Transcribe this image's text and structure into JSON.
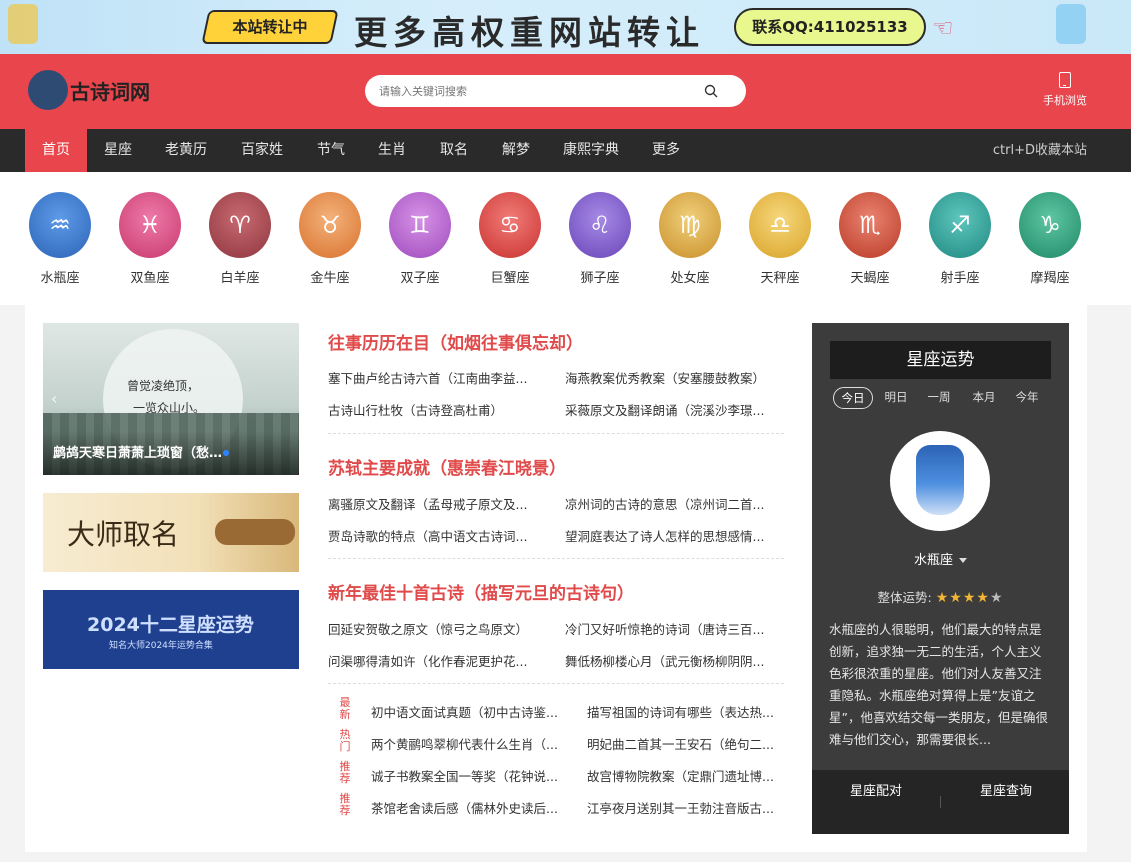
{
  "banner": {
    "tag": "本站转让中",
    "title": "更多高权重网站转让",
    "contact": "联系QQ:411025133"
  },
  "header": {
    "logo_text": "古诗词网",
    "search_placeholder": "请输入关键词搜索",
    "mobile_label": "手机浏览"
  },
  "nav": {
    "items": [
      "首页",
      "星座",
      "老黄历",
      "百家姓",
      "节气",
      "生肖",
      "取名",
      "解梦",
      "康熙字典",
      "更多"
    ],
    "active_index": 0,
    "bookmark_hint": "ctrl+D收藏本站"
  },
  "zodiac": [
    {
      "name": "水瓶座",
      "color": "#3d7fd6"
    },
    {
      "name": "双鱼座",
      "color": "#d6487e"
    },
    {
      "name": "白羊座",
      "color": "#a3404a"
    },
    {
      "name": "金牛座",
      "color": "#e0843a"
    },
    {
      "name": "双子座",
      "color": "#b055c9"
    },
    {
      "name": "巨蟹座",
      "color": "#d9413f"
    },
    {
      "name": "狮子座",
      "color": "#7b55c9"
    },
    {
      "name": "处女座",
      "color": "#d9a23c"
    },
    {
      "name": "天秤座",
      "color": "#e2b23a"
    },
    {
      "name": "天蝎座",
      "color": "#c94836"
    },
    {
      "name": "射手座",
      "color": "#2a9a93"
    },
    {
      "name": "摩羯座",
      "color": "#2a9a7a"
    }
  ],
  "left": {
    "slider_caption": "鹧鸪天寒日萧萧上琐窗（愁…",
    "slider_calligraphy_1": "曾觉凌绝顶，",
    "slider_calligraphy_2": "一览众山小。",
    "ad1_text": "大师取名",
    "ad2_title": "2024十二星座运势",
    "ad2_subtitle": "知名大师2024年运势合集"
  },
  "groups": [
    {
      "title": "往事历历在目（如烟往事俱忘却）",
      "links": [
        "塞下曲卢纶古诗六首（江南曲李益...",
        "海燕教案优秀教案（安塞腰鼓教案）",
        "古诗山行杜牧（古诗登高杜甫）",
        "采薇原文及翻译朗诵（浣溪沙李璟..."
      ]
    },
    {
      "title": "苏轼主要成就（惠崇春江晓景）",
      "links": [
        "离骚原文及翻译（孟母戒子原文及...",
        "凉州词的古诗的意思（凉州词二首...",
        "贾岛诗歌的特点（高中语文古诗词...",
        "望洞庭表达了诗人怎样的思想感情..."
      ]
    },
    {
      "title": "新年最佳十首古诗（描写元旦的古诗句）",
      "links": [
        "回延安贺敬之原文（惊弓之鸟原文）",
        "冷门又好听惊艳的诗词（唐诗三百...",
        "问渠哪得清如许（化作春泥更护花...",
        "舞低杨柳楼心月（武元衡杨柳阴阴..."
      ]
    }
  ],
  "lists": [
    {
      "tag": "最新",
      "links": [
        "初中语文面试真题（初中古诗鉴...",
        "描写祖国的诗词有哪些（表达热..."
      ]
    },
    {
      "tag": "热门",
      "links": [
        "两个黄鹂鸣翠柳代表什么生肖（...",
        "明妃曲二首其一王安石（绝句二..."
      ]
    },
    {
      "tag": "推荐",
      "links": [
        "诚子书教案全国一等奖（花钟说...",
        "故宫博物院教案（定鼎门遗址博..."
      ]
    },
    {
      "tag": "推荐",
      "links": [
        "茶馆老舍读后感（儒林外史读后...",
        "江亭夜月送别其一王勃注音版古..."
      ]
    }
  ],
  "horoscope": {
    "title": "星座运势",
    "tabs": [
      "今日",
      "明日",
      "一周",
      "本月",
      "今年"
    ],
    "active_tab": 0,
    "sign": "水瓶座",
    "overall_label": "整体运势:",
    "rating": 4,
    "rating_max": 5,
    "description": "水瓶座的人很聪明，他们最大的特点是创新，追求独一无二的生活，个人主义色彩很浓重的星座。他们对人友善又注重隐私。水瓶座绝对算得上是”友谊之星”，他喜欢结交每一类朋友，但是确很难与他们交心，那需要很长...",
    "footer_left": "星座配对",
    "footer_right": "星座查询"
  }
}
